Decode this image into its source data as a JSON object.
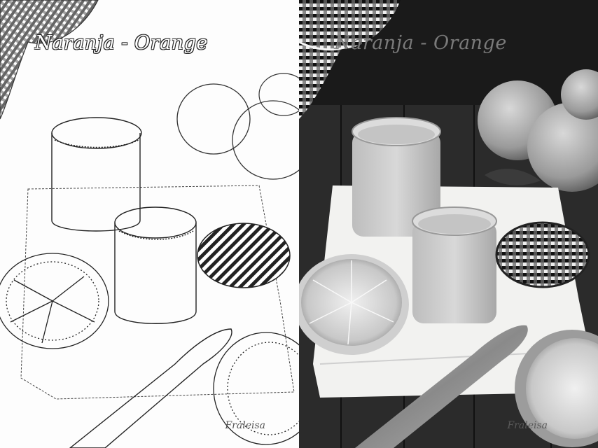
{
  "caption": "Naranja - Orange",
  "signature": "Fraleisa",
  "panels": [
    {
      "name": "sketch-version",
      "style": "pencil line drawing"
    },
    {
      "name": "photo-version",
      "style": "black and white photograph"
    }
  ],
  "colors": {
    "sketch_background": "#fdfdfd",
    "photo_background": "#1a1a1a",
    "cloth": "#f2f2f0",
    "caption_gray": "#7a7a7a"
  }
}
